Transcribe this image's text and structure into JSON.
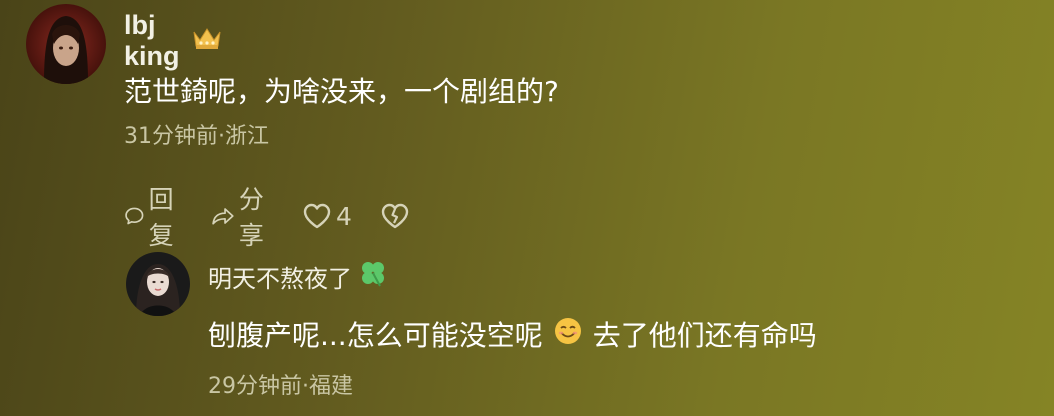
{
  "comment": {
    "username": "lbj king",
    "badge_icon": "crown-icon",
    "text": "范世錡呢，为啥没来，一个剧组的?",
    "meta": "31分钟前·浙江",
    "actions": {
      "reply_label": "回复",
      "share_label": "分享",
      "like_count": "4"
    }
  },
  "reply": {
    "username": "明天不熬夜了",
    "badge_icon": "clover-icon",
    "text_before_emoji": "刨腹产呢...怎么可能没空呢",
    "emoji": "smiling-face-icon",
    "text_after_emoji": "去了他们还有命吗",
    "meta": "29分钟前·福建"
  },
  "colors": {
    "background_start": "#4a4418",
    "background_end": "#858425",
    "crown": "#f2c14e",
    "clover": "#5cc86a",
    "emoji": "#f6c443"
  }
}
